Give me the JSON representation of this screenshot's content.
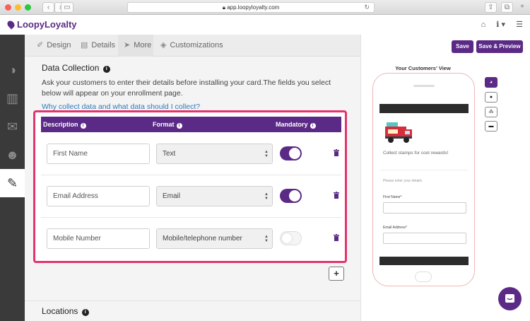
{
  "browser": {
    "url": "app.loopyloyalty.com"
  },
  "app": {
    "brand": "LoopyLoyalty"
  },
  "tabs": [
    {
      "label": "Design"
    },
    {
      "label": "Details"
    },
    {
      "label": "More"
    },
    {
      "label": "Customizations"
    }
  ],
  "actions": {
    "save": "Save",
    "save_preview": "Save & Preview"
  },
  "data_collection": {
    "title": "Data Collection",
    "description": "Ask your customers to enter their details before installing your card.The fields you select below will appear on your enrollment page.",
    "link": "Why collect data and what data should I collect?",
    "columns": {
      "description": "Description",
      "format": "Format",
      "mandatory": "Mandatory"
    },
    "rows": [
      {
        "description": "First Name",
        "format": "Text",
        "mandatory": true
      },
      {
        "description": "Email Address",
        "format": "Email",
        "mandatory": true
      },
      {
        "description": "Mobile Number",
        "format": "Mobile/telephone number",
        "mandatory": false
      }
    ],
    "add_label": "+"
  },
  "locations": {
    "title": "Locations"
  },
  "preview": {
    "title": "Your Customers' View",
    "tagline": "Collect stamps for cool rewards!",
    "prompt": "Please enter your details",
    "fields": [
      "First Name*",
      "Email Address*"
    ]
  },
  "colors": {
    "brand": "#5b2a86",
    "highlight": "#e5336d",
    "link": "#2b7bb9"
  },
  "icons": {
    "sidebar": [
      "dashboard-icon",
      "chart-icon",
      "chat-icon",
      "users-icon",
      "pencil-icon"
    ],
    "device": [
      "android-icon",
      "apple-icon",
      "blackberry-icon",
      "sms-icon"
    ]
  }
}
